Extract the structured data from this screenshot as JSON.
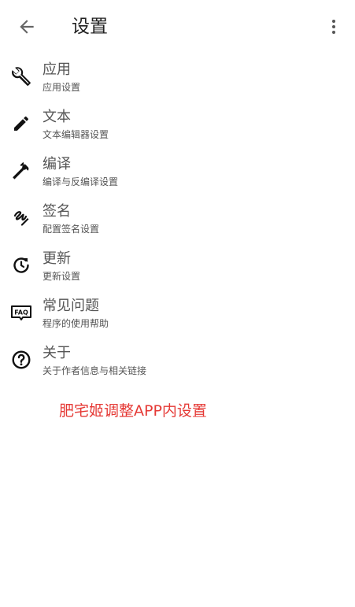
{
  "header": {
    "title": "设置",
    "back_icon": "arrow-left-icon",
    "more_icon": "more-vertical-icon"
  },
  "items": [
    {
      "title": "应用",
      "subtitle": "应用设置",
      "icon": "wrench-icon"
    },
    {
      "title": "文本",
      "subtitle": "文本编辑器设置",
      "icon": "pencil-icon"
    },
    {
      "title": "编译",
      "subtitle": "编译与反编译设置",
      "icon": "hammer-icon"
    },
    {
      "title": "签名",
      "subtitle": "配置签名设置",
      "icon": "signature-icon"
    },
    {
      "title": "更新",
      "subtitle": "更新设置",
      "icon": "update-icon"
    },
    {
      "title": "常见问题",
      "subtitle": "程序的使用帮助",
      "icon": "faq-icon",
      "icon_text": "FAQ"
    },
    {
      "title": "关于",
      "subtitle": "关于作者信息与相关链接",
      "icon": "help-circle-icon"
    }
  ],
  "note": {
    "text": "肥宅姬调整APP内设置",
    "color": "#e53935"
  },
  "colors": {
    "icon": "#111111",
    "text": "#555555",
    "title": "#222222"
  }
}
